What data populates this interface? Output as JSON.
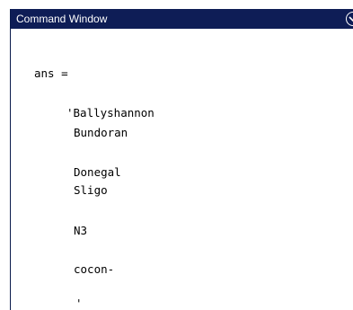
{
  "window": {
    "title": "Command Window",
    "actions_icon": "chevron-down-circle-icon"
  },
  "output": {
    "lines": [
      "ans =",
      "'Ballyshannon",
      "Bundoran",
      "Donegal",
      "Sligo",
      "N3",
      "cocon-",
      "'"
    ]
  }
}
